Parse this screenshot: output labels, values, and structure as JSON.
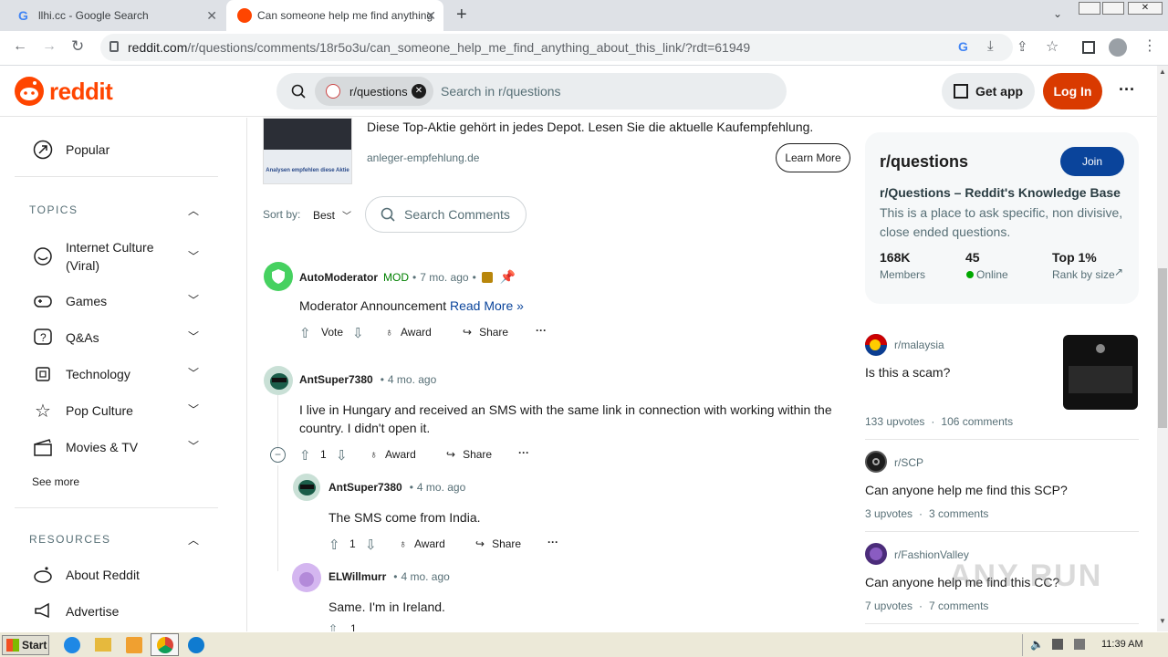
{
  "browser": {
    "tabs": [
      {
        "title": "llhi.cc - Google Search"
      },
      {
        "title": "Can someone help me find anything"
      }
    ],
    "url_host": "reddit.com",
    "url_path": "/r/questions/comments/18r5o3u/can_someone_help_me_find_anything_about_this_link/?rdt=61949"
  },
  "header": {
    "logo_text": "reddit",
    "search_chip": "r/questions",
    "search_placeholder": "Search in r/questions",
    "get_app": "Get app",
    "login": "Log In"
  },
  "sidebar": {
    "popular": "Popular",
    "topics_title": "TOPICS",
    "topics": [
      {
        "label": "Internet Culture (Viral)"
      },
      {
        "label": "Games"
      },
      {
        "label": "Q&As"
      },
      {
        "label": "Technology"
      },
      {
        "label": "Pop Culture"
      },
      {
        "label": "Movies & TV"
      }
    ],
    "see_more": "See more",
    "resources_title": "RESOURCES",
    "resources": [
      {
        "label": "About Reddit"
      },
      {
        "label": "Advertise"
      }
    ]
  },
  "ad": {
    "text": "Diese Top-Aktie gehört in jedes Depot. Lesen Sie die aktuelle Kaufempfehlung.",
    "domain": "anleger-empfehlung.de",
    "cta": "Learn More",
    "thumb_caption": "Analysen empfehlen diese Aktie"
  },
  "sort": {
    "label": "Sort by:",
    "value": "Best",
    "search_comments": "Search Comments"
  },
  "comments": [
    {
      "user": "AutoModerator",
      "badge": "MOD",
      "time": "7 mo. ago",
      "text": "Moderator Announcement",
      "link": "Read More »",
      "vote": "Vote",
      "award": "Award",
      "share": "Share"
    },
    {
      "user": "AntSuper7380",
      "time": "4 mo. ago",
      "text": "I live in Hungary and received an SMS with the same link in connection with working within the country. I didn't open it.",
      "score": "1",
      "award": "Award",
      "share": "Share"
    },
    {
      "user": "AntSuper7380",
      "time": "4 mo. ago",
      "text": "The SMS come from India.",
      "score": "1",
      "award": "Award",
      "share": "Share"
    },
    {
      "user": "ELWillmurr",
      "time": "4 mo. ago",
      "text": "Same. I'm in Ireland.",
      "score": "1"
    }
  ],
  "community": {
    "name": "r/questions",
    "join": "Join",
    "title": "r/Questions – Reddit's Knowledge Base",
    "description": "This is a place to ask specific, non divisive, close ended questions.",
    "members_value": "168K",
    "members_label": "Members",
    "online_value": "45",
    "online_label": "Online",
    "rank_value": "Top 1%",
    "rank_label": "Rank by size"
  },
  "related": [
    {
      "sub": "r/malaysia",
      "title": "Is this a scam?",
      "upvotes": "133 upvotes",
      "comments": "106 comments"
    },
    {
      "sub": "r/SCP",
      "title": "Can anyone help me find this SCP?",
      "upvotes": "3 upvotes",
      "comments": "3 comments"
    },
    {
      "sub": "r/FashionValley",
      "title": "Can anyone help me find this CC?",
      "upvotes": "7 upvotes",
      "comments": "7 comments"
    }
  ],
  "taskbar": {
    "start": "Start",
    "clock": "11:39 AM"
  },
  "watermark": "ANY RUN",
  "colors": {
    "reddit_orange": "#ff4500",
    "login_btn": "#d93a00",
    "join_btn": "#0a449b",
    "mod_green": "#008000",
    "online_green": "#00a800"
  }
}
